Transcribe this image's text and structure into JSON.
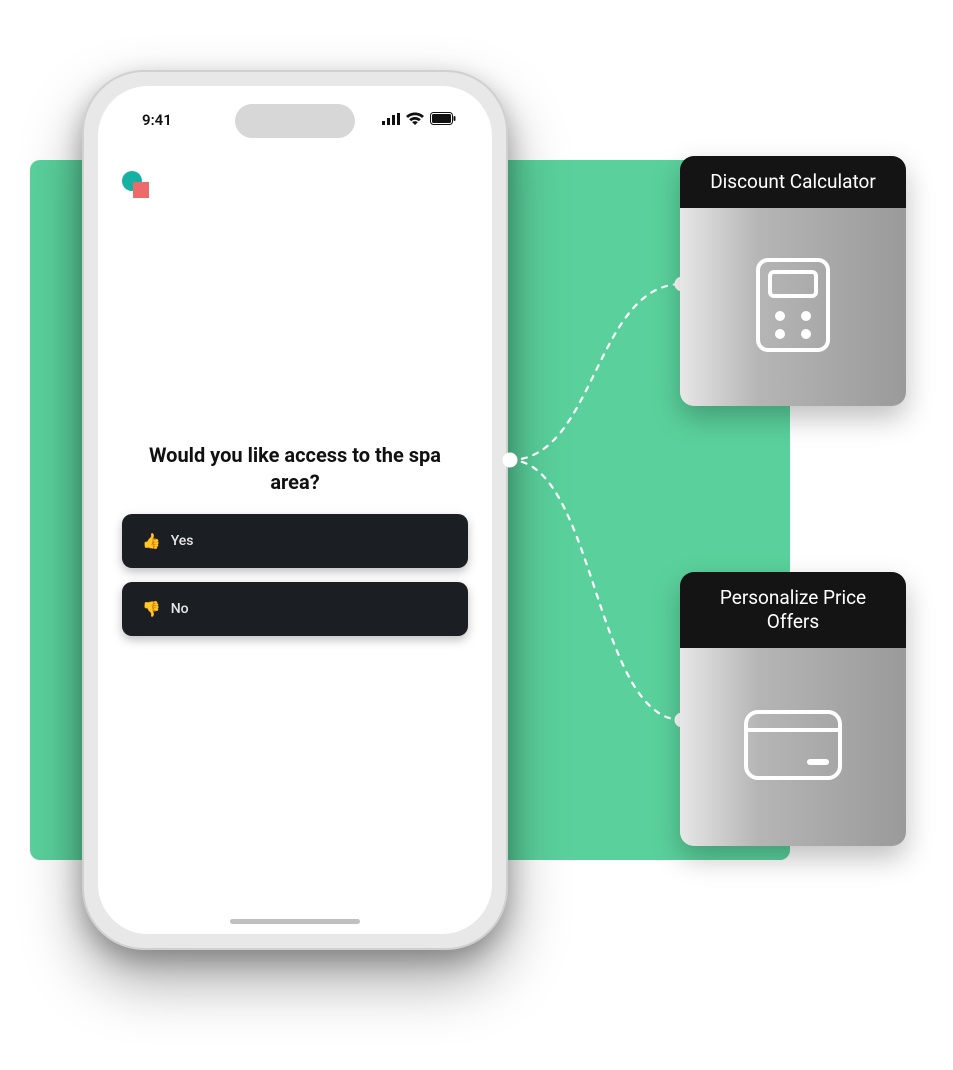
{
  "statusBar": {
    "time": "9:41"
  },
  "survey": {
    "question": "Would you like access to the spa area?",
    "options": [
      {
        "emoji": "👍",
        "label": "Yes"
      },
      {
        "emoji": "👎",
        "label": "No"
      }
    ]
  },
  "cards": [
    {
      "title": "Discount Calculator",
      "icon": "calculator"
    },
    {
      "title": "Personalize Price Offers",
      "icon": "credit-card"
    }
  ]
}
